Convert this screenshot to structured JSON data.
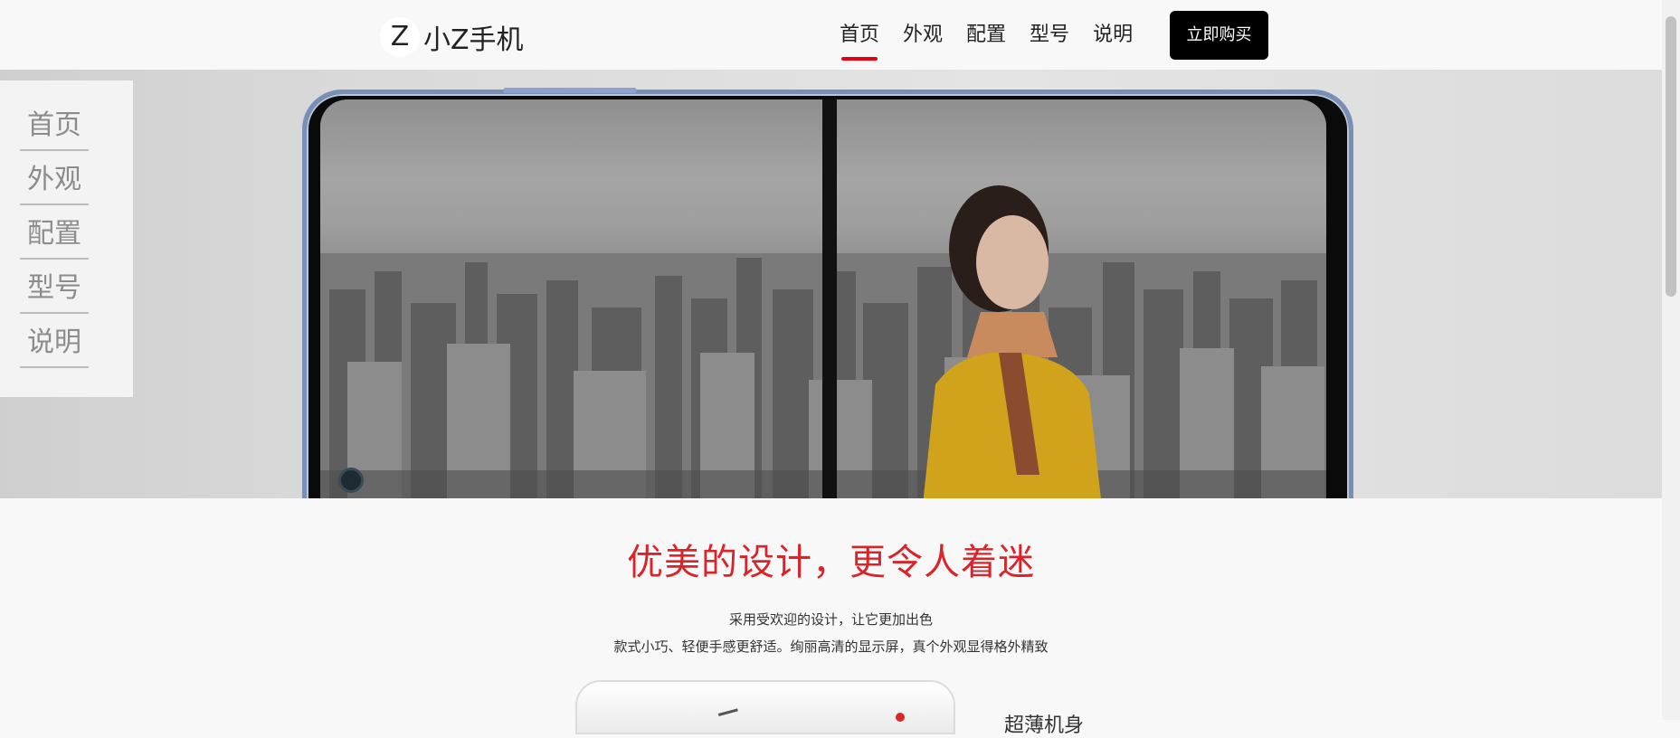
{
  "header": {
    "logo_mark": "Z",
    "logo_text": "小Z手机",
    "nav": [
      {
        "label": "首页",
        "active": true
      },
      {
        "label": "外观",
        "active": false
      },
      {
        "label": "配置",
        "active": false
      },
      {
        "label": "型号",
        "active": false
      },
      {
        "label": "说明",
        "active": false
      }
    ],
    "buy_label": "立即购买"
  },
  "side_menu": {
    "items": [
      "首页",
      "外观",
      "配置",
      "型号",
      "说明"
    ]
  },
  "section": {
    "title": "优美的设计，更令人着迷",
    "desc1": "采用受欢迎的设计，让它更加出色",
    "desc2": "款式小巧、轻便手感更舒适。绚丽高清的显示屏，真个外观显得格外精致",
    "feature_label": "超薄机身"
  },
  "colors": {
    "accent": "#e60012",
    "title_red": "#d9252a",
    "button_bg": "#000000"
  }
}
